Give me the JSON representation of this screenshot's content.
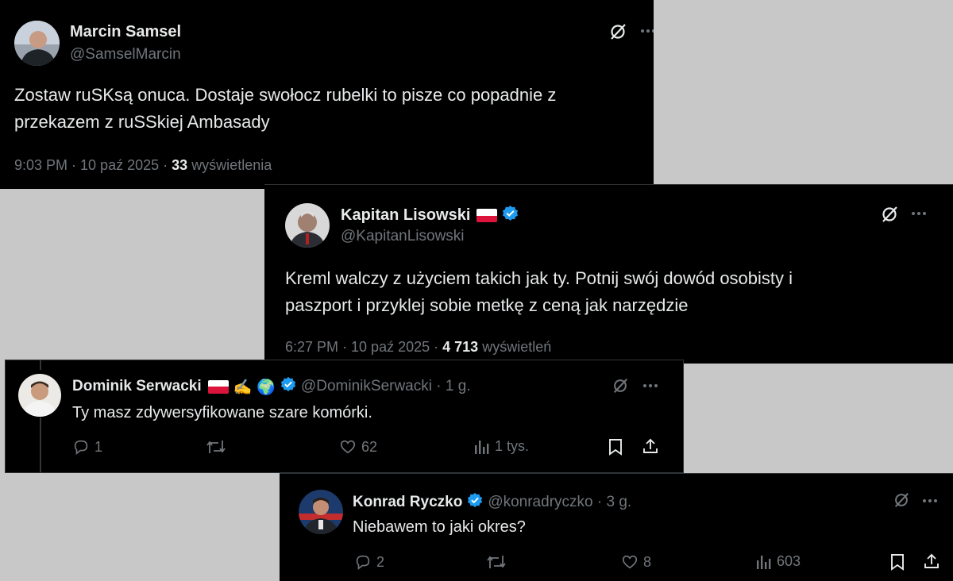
{
  "tweets": [
    {
      "name": "Marcin Samsel",
      "handle": "@SamselMarcin",
      "text_line1": "Zostaw ruSKsą onuca. Dostaje swołocz rubelki to pisze co popadnie z",
      "text_line2": "przekazem z ruSSkiej Ambasady",
      "time": "9:03 PM · 10 paź 2025 ·",
      "views_count": "33",
      "views_label": "wyświetlenia"
    },
    {
      "name": "Kapitan Lisowski",
      "handle": "@KapitanLisowski",
      "text_line1": "Kreml walczy z użyciem takich jak ty. Potnij swój dowód osobisty i",
      "text_line2": "paszport i przyklej sobie metkę z ceną jak narzędzie",
      "time": "6:27 PM · 10 paź 2025 ·",
      "views_count": "4 713",
      "views_label": "wyświetleń"
    },
    {
      "name": "Dominik Serwacki",
      "emoji": "✍️ 🌍",
      "handle": "@DominikSerwacki · 1 g.",
      "text": "Ty masz zdywersyfikowane szare komórki.",
      "replies": "1",
      "likes": "62",
      "views": "1 tys."
    },
    {
      "name": "Konrad Ryczko",
      "handle": "@konradryczko · 3 g.",
      "text": "Niebawem to jaki okres?",
      "replies": "2",
      "likes": "8",
      "views": "603"
    }
  ],
  "colors": {
    "background": "#000000",
    "text": "#e7e9ea",
    "muted": "#71767b",
    "verified": "#1d9bf0",
    "gap": "#c8c8c8"
  },
  "icons": [
    "grok-icon",
    "more-icon",
    "verified-icon",
    "reply-icon",
    "retweet-icon",
    "like-icon",
    "views-icon",
    "bookmark-icon",
    "share-icon"
  ]
}
